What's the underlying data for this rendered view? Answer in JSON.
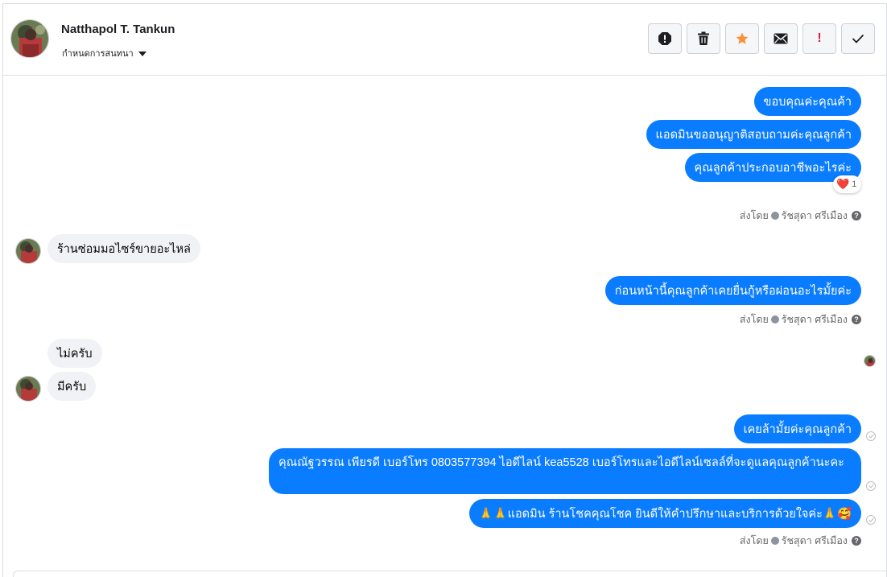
{
  "contact": {
    "name": "Natthapol T. Tankun",
    "label_menu": "กำหนดการสนทนา"
  },
  "toolbar": {
    "icons": [
      "report-icon",
      "trash-icon",
      "star-icon",
      "mail-icon",
      "important-icon",
      "check-icon"
    ],
    "important_glyph": "!",
    "accent_star": "#f7923b",
    "accent_important": "#e41e3f"
  },
  "messages": [
    {
      "dir": "out",
      "text": "ขอบคุณค่ะคุณค้า"
    },
    {
      "dir": "out",
      "text": "แอดมินขออนุญาติสอบถามค่ะคุณลูกค้า"
    },
    {
      "dir": "out",
      "text": "คุณลูกค้าประกอบอาชีพอะไรค่ะ",
      "reaction": {
        "emoji": "❤️",
        "count": "1"
      }
    },
    {
      "dir": "in",
      "text": "ร้านซ่อมมอไซร์ขายอะไหล่"
    },
    {
      "dir": "out",
      "text": "ก่อนหน้านี้คุณลูกค้าเคยยื่นกู้หรือผ่อนอะไรมั้ยค่ะ"
    },
    {
      "dir": "in",
      "text": "ไม่ครับ"
    },
    {
      "dir": "in",
      "text": "มีครับ"
    },
    {
      "dir": "out",
      "text": "เคยล้ามั้ยค่ะคุณลูกค้า"
    },
    {
      "dir": "out",
      "text": "คุณณัฐวรรณ เพียรดี        เบอร์โทร 0803577394  ไอดีไลน์ kea5528   เบอร์โทรและไอดีไลน์เซลล์ที่จะดูแลคุณลูกค้านะคะ"
    },
    {
      "dir": "out",
      "text": "🙏🙏แอดมิน ร้านโชคคุณโชค ยินดีให้คำปรึกษาและบริการด้วยใจค่ะ🙏🥰"
    }
  ],
  "sent_by": {
    "prefix": "ส่งโดย",
    "agent": "รัชสุดา ศรีเมือง",
    "help": "?"
  },
  "colors": {
    "outgoing_bubble": "#0a7cff",
    "incoming_bubble": "#f0f2f5",
    "meta_text": "#65676b"
  }
}
